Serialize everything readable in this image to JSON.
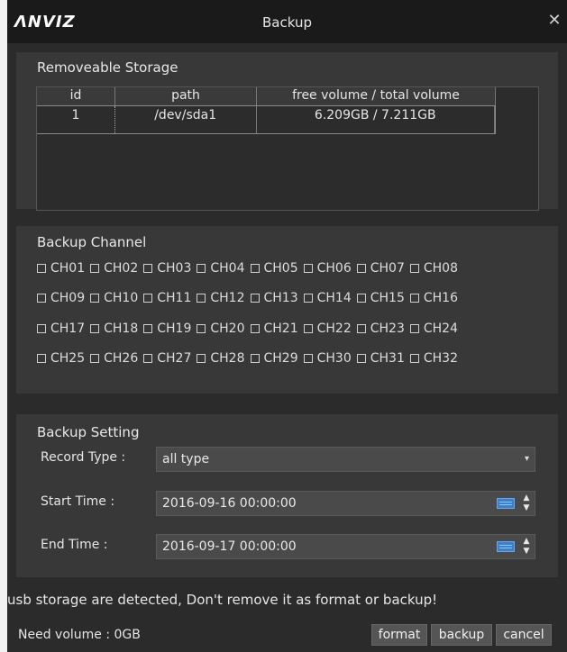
{
  "window": {
    "title": "Backup",
    "logo": "ΛNVIZ",
    "close_glyph": "✕"
  },
  "storage": {
    "title": "Removeable Storage",
    "columns": [
      "id",
      "path",
      "free volume / total volume"
    ],
    "rows": [
      {
        "id": "1",
        "path": "/dev/sda1",
        "volume": "6.209GB / 7.211GB"
      }
    ]
  },
  "channels": {
    "title": "Backup Channel",
    "items": [
      "CH01",
      "CH02",
      "CH03",
      "CH04",
      "CH05",
      "CH06",
      "CH07",
      "CH08",
      "CH09",
      "CH10",
      "CH11",
      "CH12",
      "CH13",
      "CH14",
      "CH15",
      "CH16",
      "CH17",
      "CH18",
      "CH19",
      "CH20",
      "CH21",
      "CH22",
      "CH23",
      "CH24",
      "CH25",
      "CH26",
      "CH27",
      "CH28",
      "CH29",
      "CH30",
      "CH31",
      "CH32"
    ]
  },
  "settings": {
    "title": "Backup Setting",
    "record_type_label": "Record Type :",
    "record_type_value": "all type",
    "start_label": "Start Time :",
    "start_value": "2016-09-16 00:00:00",
    "end_label": "End Time :",
    "end_value": "2016-09-17 00:00:00"
  },
  "footer": {
    "warning": "usb storage are detected, Don't remove it as format or backup!",
    "need_volume": "Need volume : 0GB",
    "format_label": "format",
    "backup_label": "backup",
    "cancel_label": "cancel"
  },
  "colors": {
    "window_bg": "#2b2b2b",
    "panel_bg": "#383838",
    "titlebar_bg": "#1a1a1a",
    "calendar_icon": "#3a7fd0"
  }
}
